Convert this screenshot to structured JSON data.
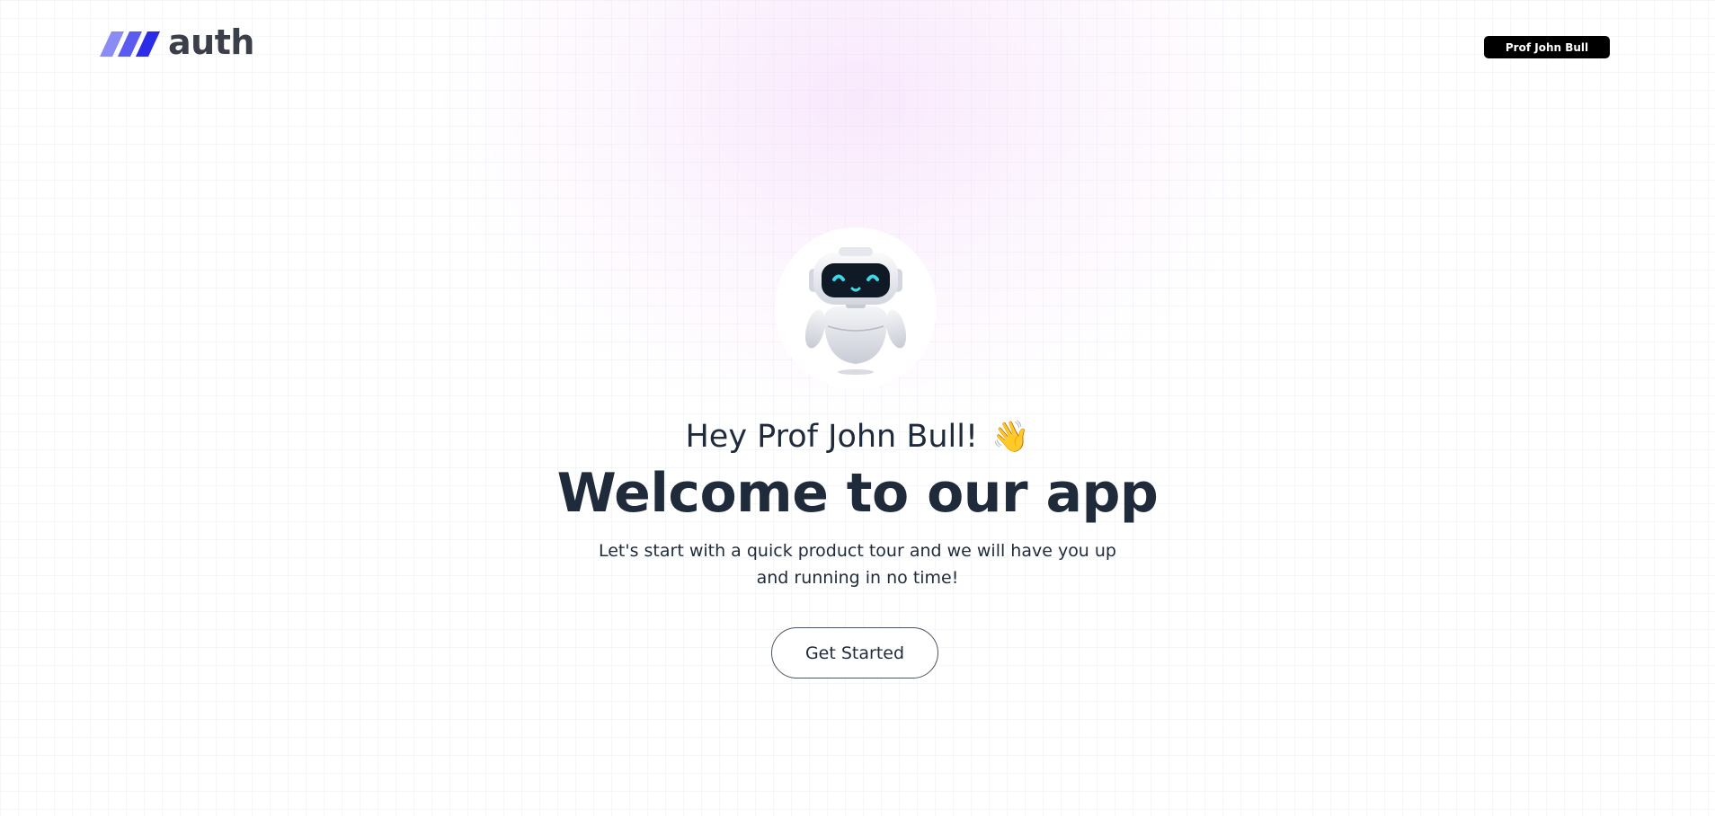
{
  "brand": {
    "name": "auth",
    "logo_colors": [
      "#8b8bf5",
      "#5b5bf0",
      "#2b2bea"
    ]
  },
  "header": {
    "user_button_label": "Prof John Bull"
  },
  "hero": {
    "avatar_icon": "robot-icon",
    "greeting": "Hey Prof John Bull!",
    "greeting_icon": "waving-hand-icon",
    "title": "Welcome to our app",
    "description": "Let's start with a quick product tour and we will have you up and running in no time!",
    "cta_label": "Get Started"
  },
  "colors": {
    "text": "#1f2a3b",
    "user_button_bg": "#000000",
    "glow": "#f3d6fa"
  }
}
